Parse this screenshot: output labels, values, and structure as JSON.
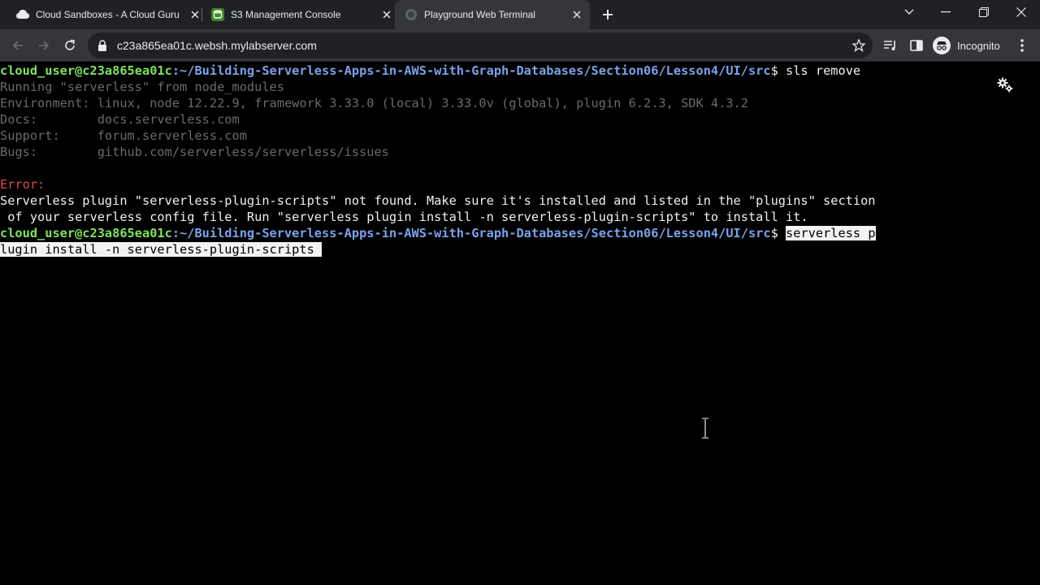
{
  "browser": {
    "tabs": [
      {
        "title": "Cloud Sandboxes - A Cloud Guru",
        "icon": "acg-logo-icon",
        "active": false
      },
      {
        "title": "S3 Management Console",
        "icon": "aws-s3-icon",
        "active": false
      },
      {
        "title": "Playground Web Terminal",
        "icon": "globe-icon",
        "active": true
      }
    ],
    "address": "c23a865ea01c.websh.mylabserver.com",
    "profile_label": "Incognito",
    "colors": {
      "frame": "#202124",
      "toolbar": "#35363a",
      "text": "#e8eaed"
    }
  },
  "terminal": {
    "prompt_user": "cloud_user@c23a865ea01c",
    "prompt_path": ":~/Building-Serverless-Apps-in-AWS-with-Graph-Databases/Section06/Lesson4/UI/src",
    "prompt_symbol": "$ ",
    "command_1": "sls remove",
    "output": [
      "Running \"serverless\" from node_modules",
      "Environment: linux, node 12.22.9, framework 3.33.0 (local) 3.33.0v (global), plugin 6.2.3, SDK 4.3.2",
      "Docs:        docs.serverless.com",
      "Support:     forum.serverless.com",
      "Bugs:        github.com/serverless/serverless/issues"
    ],
    "error_label": "Error:",
    "error_lines": [
      "Serverless plugin \"serverless-plugin-scripts\" not found. Make sure it's installed and listed in the \"plugins\" section",
      " of your serverless config file. Run \"serverless plugin install -n serverless-plugin-scripts\" to install it."
    ],
    "command_2_part1": "serverless p",
    "command_2_part2": "lugin install -n serverless-plugin-scripts ",
    "colors": {
      "user": "#7ee35a",
      "path": "#7aa2e8",
      "dim": "#6a6a6a",
      "error": "#e0474c"
    }
  }
}
